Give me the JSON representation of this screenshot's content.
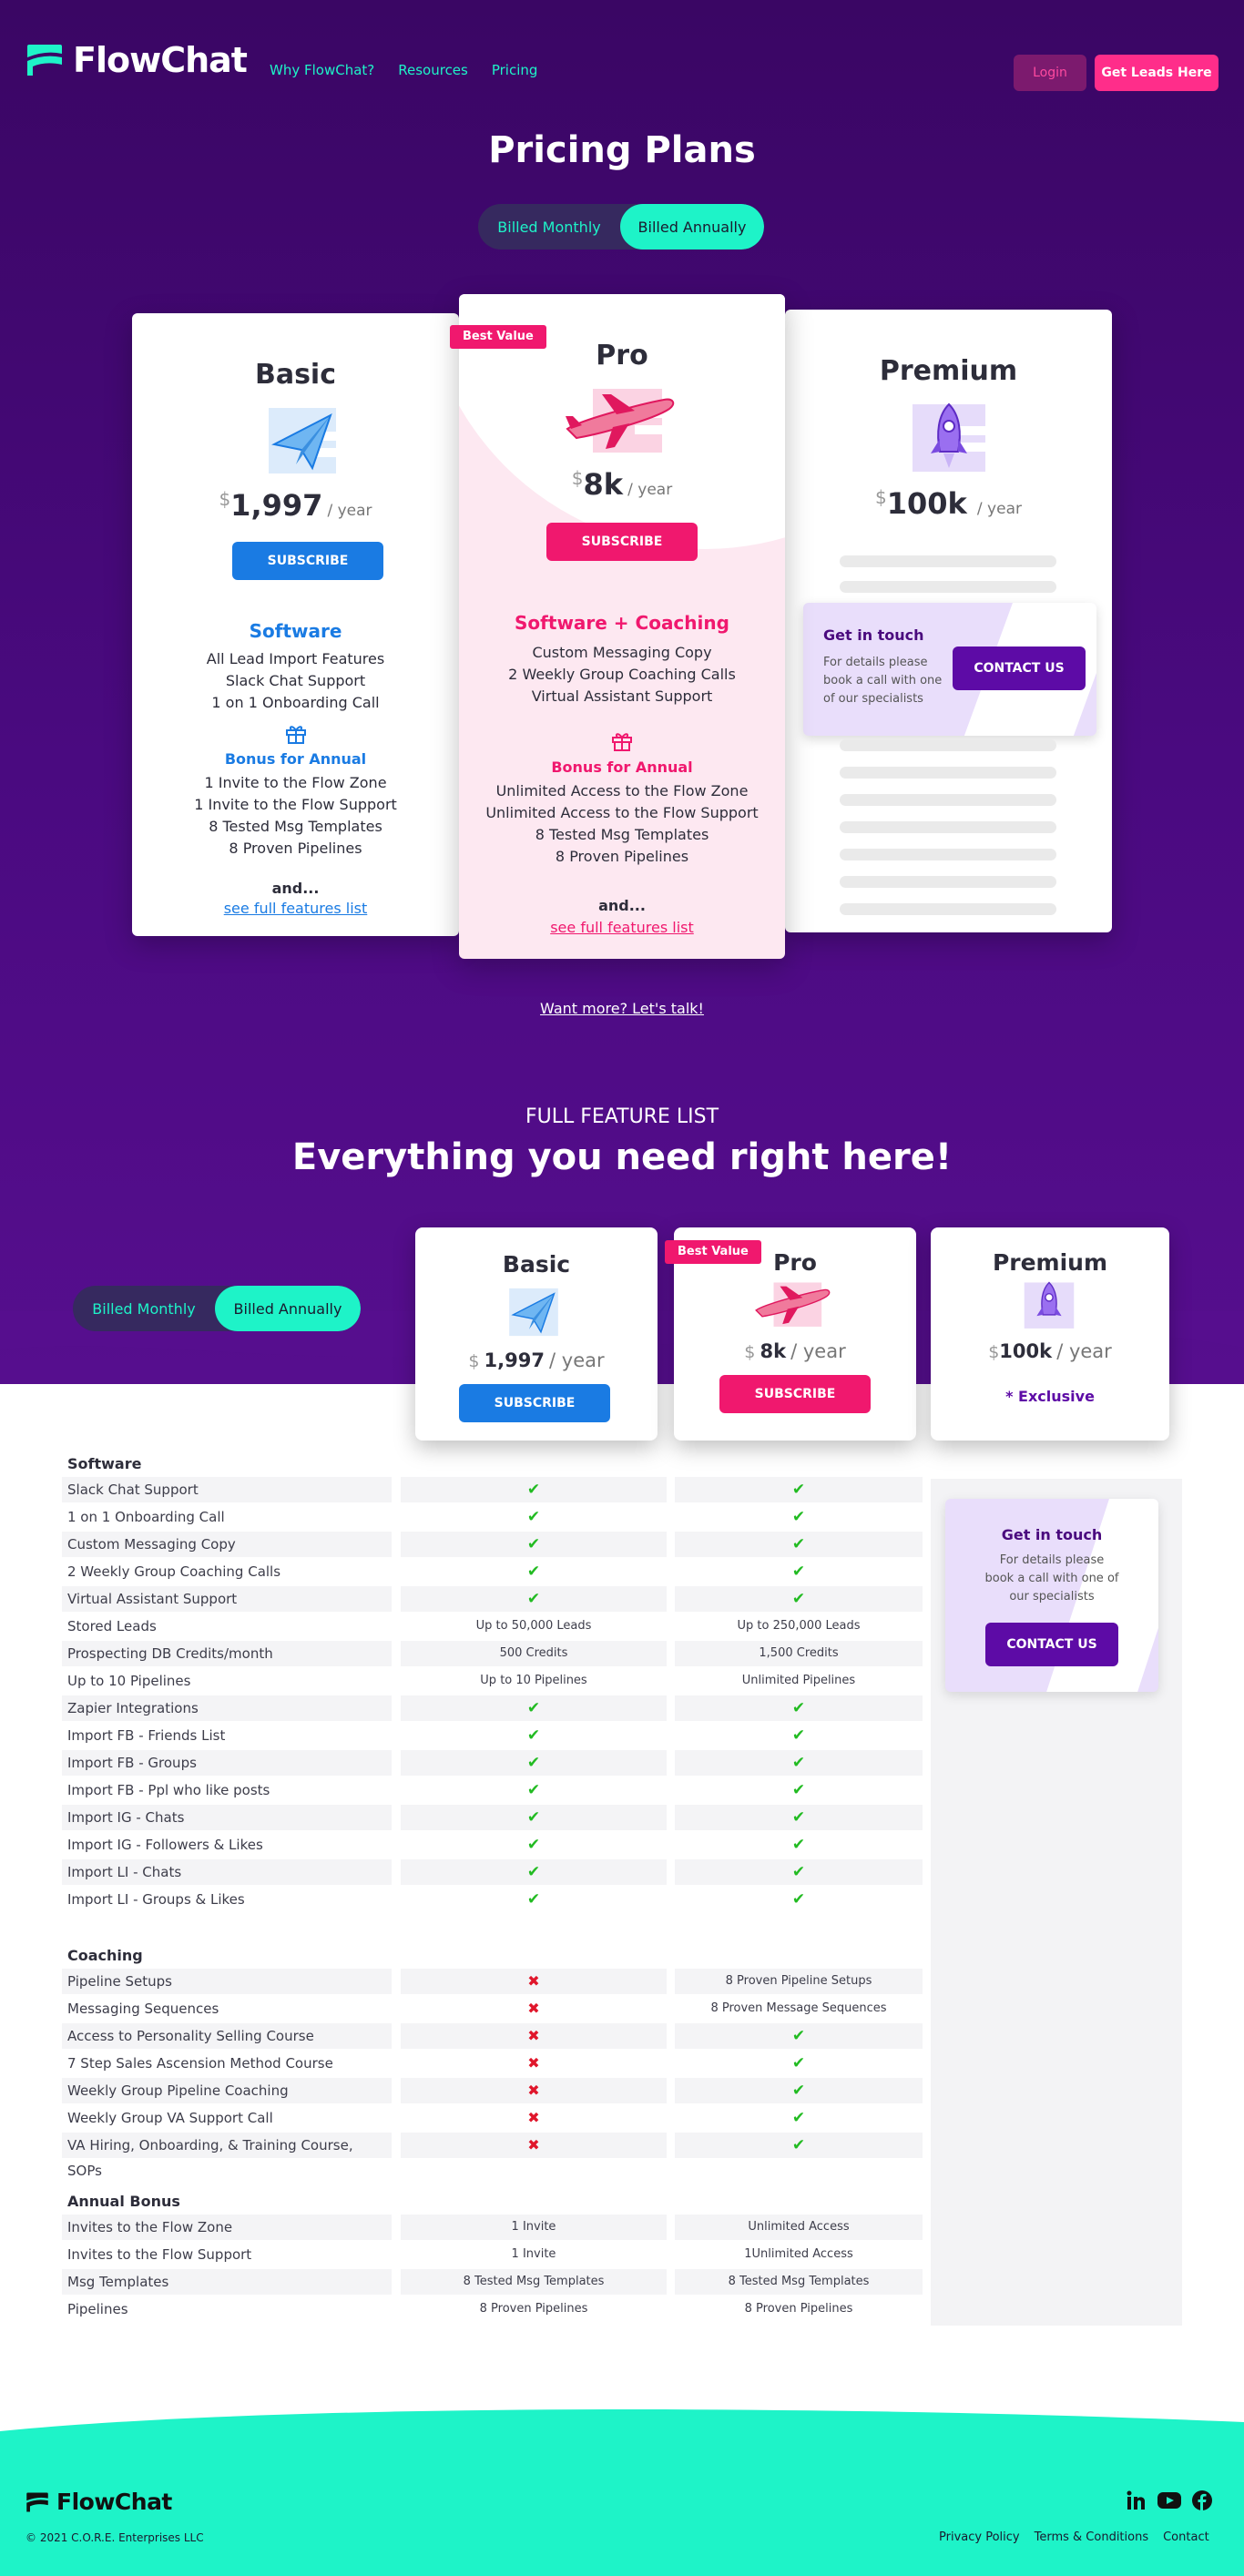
{
  "nav": {
    "brand": "FlowChat",
    "links": [
      "Why FlowChat?",
      "Resources",
      "Pricing"
    ],
    "login": "Login",
    "cta": "Get Leads Here"
  },
  "colors": {
    "accent": "#1ef3c8",
    "pink": "#f0186e",
    "blue": "#1a7be3",
    "purple": "#5d0ba6",
    "bg": "#4a0a80"
  },
  "hero": {
    "title": "Pricing Plans",
    "billing": {
      "monthly": "Billed Monthly",
      "annually": "Billed Annually",
      "selected": "Billed Annually"
    }
  },
  "plans": {
    "basic": {
      "name": "Basic",
      "currency": "$",
      "amount": "1,997",
      "period": "/ year",
      "button": "SUBSCRIBE",
      "icon": "paper-plane-icon",
      "heading": "Software",
      "features": [
        "All Lead Import Features",
        "Slack Chat Support",
        "1 on 1 Onboarding Call"
      ],
      "bonus_title": "Bonus for Annual",
      "bonus": [
        "1 Invite to the Flow Zone",
        "1 Invite to the Flow Support",
        "8 Tested Msg Templates",
        "8 Proven Pipelines"
      ],
      "and": "and...",
      "link": "see full features list"
    },
    "pro": {
      "name": "Pro",
      "badge": "Best Value",
      "currency": "$",
      "amount": "8k",
      "period": "/ year",
      "button": "SUBSCRIBE",
      "icon": "airplane-icon",
      "heading": "Software + Coaching",
      "features": [
        "Custom Messaging Copy",
        "2 Weekly Group Coaching Calls",
        "Virtual Assistant Support"
      ],
      "bonus_title": "Bonus for Annual",
      "bonus": [
        "Unlimited Access to the Flow Zone",
        "Unlimited Access to the Flow Support",
        "8 Tested Msg Templates",
        "8 Proven Pipelines"
      ],
      "and": "and...",
      "link": "see full features list"
    },
    "premium": {
      "name": "Premium",
      "currency": "$",
      "amount": "100k",
      "period": "/ year",
      "icon": "rocket-icon",
      "touch_title": "Get in touch",
      "touch_desc": "For details please book a call with one of our specialists",
      "contact": "CONTACT US"
    }
  },
  "want_more": "Want more? Let's talk!",
  "features": {
    "kicker": "FULL FEATURE LIST",
    "title": "Everything you need right here!",
    "billing": {
      "monthly": "Billed Monthly",
      "annually": "Billed Annually"
    },
    "basic": {
      "name": "Basic",
      "currency": "$",
      "amount": "1,997",
      "period": "/ year",
      "button": "SUBSCRIBE"
    },
    "pro": {
      "name": "Pro",
      "badge": "Best Value",
      "currency": "$",
      "amount": "8k",
      "period": "/ year",
      "button": "SUBSCRIBE"
    },
    "premium": {
      "name": "Premium",
      "currency": "$",
      "amount": "100k",
      "period": "/ year",
      "exclusive": "* Exclusive",
      "touch_title": "Get in touch",
      "touch_desc": "For details please book a call with one of our specialists",
      "contact": "CONTACT US"
    },
    "sections": [
      {
        "title": "Software",
        "rows": [
          [
            "Slack Chat Support",
            "check",
            "check"
          ],
          [
            "1 on 1 Onboarding Call",
            "check",
            "check"
          ],
          [
            "Custom Messaging Copy",
            "check",
            "check"
          ],
          [
            "2 Weekly Group Coaching Calls",
            "check",
            "check"
          ],
          [
            "Virtual Assistant Support",
            "check",
            "check"
          ],
          [
            "Stored Leads",
            "Up to 50,000 Leads",
            "Up to 250,000 Leads"
          ],
          [
            "Prospecting DB Credits/month",
            "500 Credits",
            "1,500 Credits"
          ],
          [
            "Up to 10 Pipelines",
            "Up to 10 Pipelines",
            "Unlimited Pipelines"
          ],
          [
            "Zapier Integrations",
            "check",
            "check"
          ],
          [
            "Import FB - Friends List",
            "check",
            "check"
          ],
          [
            "Import FB - Groups",
            "check",
            "check"
          ],
          [
            "Import FB - Ppl who like posts",
            "check",
            "check"
          ],
          [
            "Import IG - Chats",
            "check",
            "check"
          ],
          [
            "Import IG - Followers & Likes",
            "check",
            "check"
          ],
          [
            "Import LI - Chats",
            "check",
            "check"
          ],
          [
            "Import LI - Groups & Likes",
            "check",
            "check"
          ]
        ]
      },
      {
        "title": "Coaching",
        "rows": [
          [
            "Pipeline Setups",
            "cross",
            "8 Proven Pipeline Setups"
          ],
          [
            "Messaging Sequences",
            "cross",
            "8 Proven Message Sequences"
          ],
          [
            "Access to Personality Selling Course",
            "cross",
            "check"
          ],
          [
            "7 Step Sales Ascension Method Course",
            "cross",
            "check"
          ],
          [
            "Weekly Group Pipeline Coaching",
            "cross",
            "check"
          ],
          [
            "Weekly Group VA Support Call",
            "cross",
            "check"
          ],
          [
            "VA Hiring, Onboarding, & Training Course, SOPs",
            "cross",
            "check"
          ]
        ]
      },
      {
        "title": "Annual Bonus",
        "rows": [
          [
            "Invites to the Flow Zone",
            "1 Invite",
            "Unlimited Access"
          ],
          [
            "Invites to the Flow Support",
            "1 Invite",
            "1Unlimited Access"
          ],
          [
            "Msg Templates",
            "8 Tested Msg Templates",
            "8 Tested Msg Templates"
          ],
          [
            "Pipelines",
            "8 Proven Pipelines",
            "8 Proven Pipelines"
          ]
        ]
      }
    ]
  },
  "footer": {
    "brand": "FlowChat",
    "copyright": "© 2021 C.O.R.E. Enterprises LLC",
    "links": [
      "Privacy Policy",
      "Terms & Conditions",
      "Contact"
    ],
    "social": [
      "linkedin-icon",
      "youtube-icon",
      "facebook-icon"
    ]
  }
}
